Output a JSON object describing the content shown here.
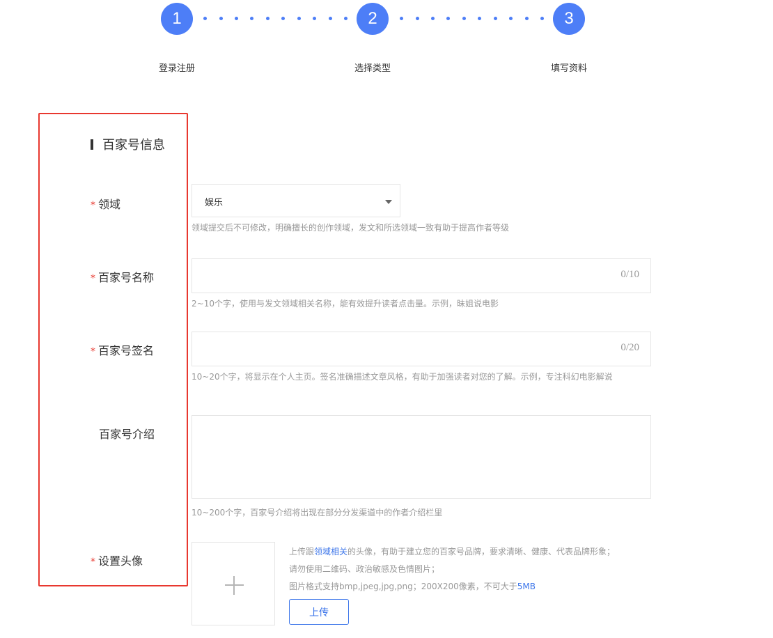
{
  "stepper": {
    "steps": [
      {
        "number": "1",
        "label": "登录注册"
      },
      {
        "number": "2",
        "label": "选择类型"
      },
      {
        "number": "3",
        "label": "填写资料"
      }
    ],
    "accent_color": "#4d7ef7"
  },
  "section": {
    "title": "百家号信息"
  },
  "form": {
    "domain": {
      "required_mark": "*",
      "label": "领域",
      "selected": "娱乐",
      "hint": "领域提交后不可修改，明确擅长的创作领域，发文和所选领域一致有助于提高作者等级"
    },
    "name": {
      "required_mark": "*",
      "label": "百家号名称",
      "counter": "0/10",
      "hint": "2~10个字，使用与发文领域相关名称，能有效提升读者点击量。示例，昧姐说电影"
    },
    "signature": {
      "required_mark": "*",
      "label": "百家号签名",
      "counter": "0/20",
      "hint": "10~20个字，将显示在个人主页。签名准确描述文章风格，有助于加强读者对您的了解。示例，专注科幻电影解说"
    },
    "intro": {
      "label": "百家号介绍",
      "hint": "10~200个字，百家号介绍将出现在部分分发渠道中的作者介绍栏里"
    },
    "avatar": {
      "required_mark": "*",
      "label": "设置头像",
      "info_line1_prefix": "上传跟",
      "info_line1_link": "领域相关",
      "info_line1_suffix": "的头像，有助于建立您的百家号品牌，要求清晰、健康、代表品牌形象；",
      "info_line2": "请勿使用二维码、政治敏感及色情图片；",
      "info_line3_prefix": "图片格式支持bmp,jpeg,jpg,png；200X200像素，不可大于",
      "info_line3_highlight": "5MB",
      "upload_label": "上传"
    }
  },
  "colors": {
    "required": "#e8382f",
    "highlight_border": "#e8382f",
    "link": "#3d76ea"
  }
}
